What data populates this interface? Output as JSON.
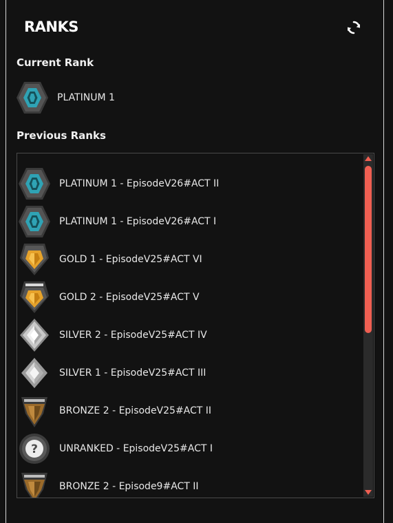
{
  "header": {
    "logo_text": "RANKS",
    "refresh_icon": "refresh-icon"
  },
  "current": {
    "section_title": "Current Rank",
    "rank_label": "PLATINUM 1",
    "icon": "platinum-rank-icon"
  },
  "previous": {
    "section_title": "Previous Ranks",
    "items": [
      {
        "label": "PLATINUM 1 - EpisodeV26#ACT II",
        "icon": "platinum"
      },
      {
        "label": "PLATINUM 1 - EpisodeV26#ACT I",
        "icon": "platinum"
      },
      {
        "label": "GOLD 1 - EpisodeV25#ACT VI",
        "icon": "gold1"
      },
      {
        "label": "GOLD 2 - EpisodeV25#ACT V",
        "icon": "gold2"
      },
      {
        "label": "SILVER 2 - EpisodeV25#ACT IV",
        "icon": "silver2"
      },
      {
        "label": "SILVER 1 - EpisodeV25#ACT III",
        "icon": "silver1"
      },
      {
        "label": "BRONZE 2 - EpisodeV25#ACT II",
        "icon": "bronze2"
      },
      {
        "label": "UNRANKED - EpisodeV25#ACT I",
        "icon": "unranked"
      },
      {
        "label": "BRONZE 2 - Episode9#ACT II",
        "icon": "bronze2"
      }
    ]
  },
  "colors": {
    "accent": "#ef5f52",
    "background": "#121212",
    "platinum": "#2fa3b5",
    "gold": "#e6a22a",
    "silver": "#c9c9c9",
    "bronze": "#9a6a2a"
  }
}
